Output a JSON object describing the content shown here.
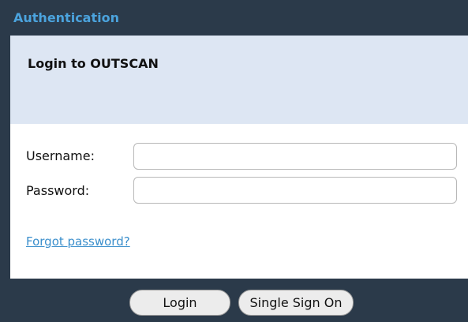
{
  "window": {
    "title": "Authentication"
  },
  "header": {
    "title": "Login to OUTSCAN"
  },
  "form": {
    "username_label": "Username:",
    "username_value": "",
    "password_label": "Password:",
    "password_value": "",
    "forgot_link": "Forgot password?"
  },
  "footer": {
    "login_label": "Login",
    "sso_label": "Single Sign On"
  },
  "colors": {
    "titlebar_bg": "#2b3a4a",
    "title_text": "#4ba3dd",
    "header_bg": "#dde6f3",
    "link": "#3b8fcc"
  }
}
